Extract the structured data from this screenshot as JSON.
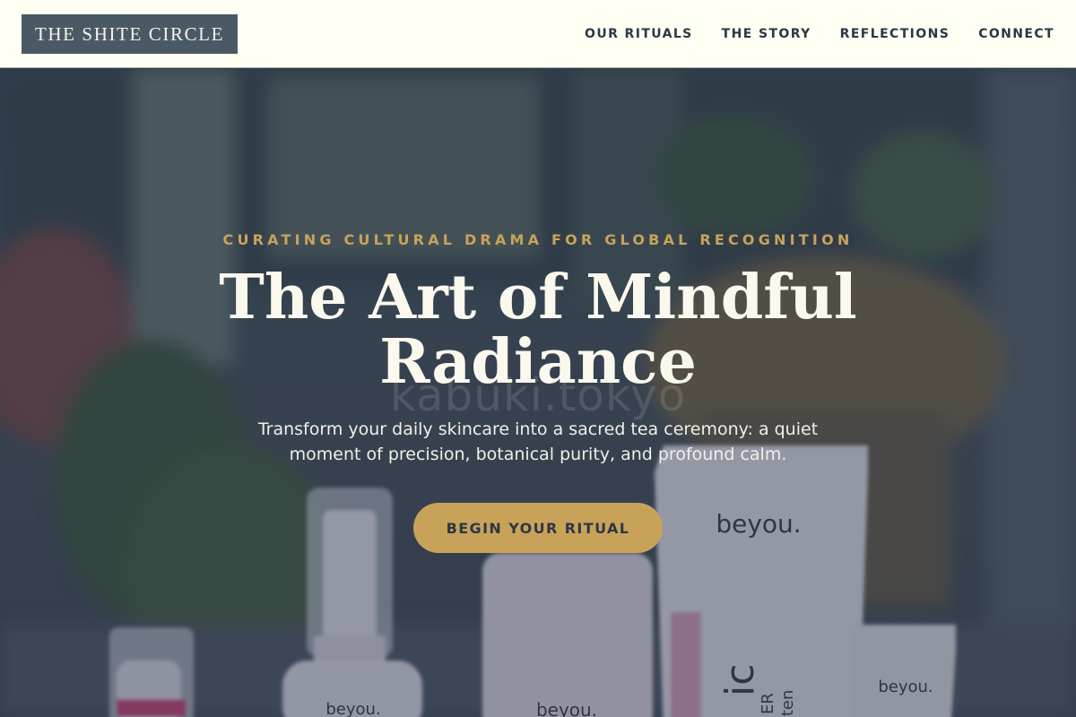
{
  "header": {
    "logo": "THE SHITE CIRCLE",
    "nav": [
      "OUR RITUALS",
      "THE STORY",
      "REFLECTIONS",
      "CONNECT"
    ]
  },
  "hero": {
    "eyebrow": "CURATING CULTURAL DRAMA FOR GLOBAL RECOGNITION",
    "title_line1": "The Art of Mindful",
    "title_line2": "Radiance",
    "watermark": "kabuki.tokyo",
    "subtitle": "Transform your daily skincare into a sacred tea ceremony: a quiet moment of precision, botanical purity, and profound calm.",
    "cta": "BEGIN YOUR RITUAL",
    "product_brand": "beyou.",
    "tube_label_big": "ic",
    "tube_label_small_1": "ER",
    "tube_label_small_2": "ighten"
  },
  "colors": {
    "header_bg": "#fffff3",
    "logo_bg": "#4b5967",
    "nav_text": "#2c3745",
    "accent_gold": "#c9a25a",
    "hero_overlay": "#212c44"
  }
}
